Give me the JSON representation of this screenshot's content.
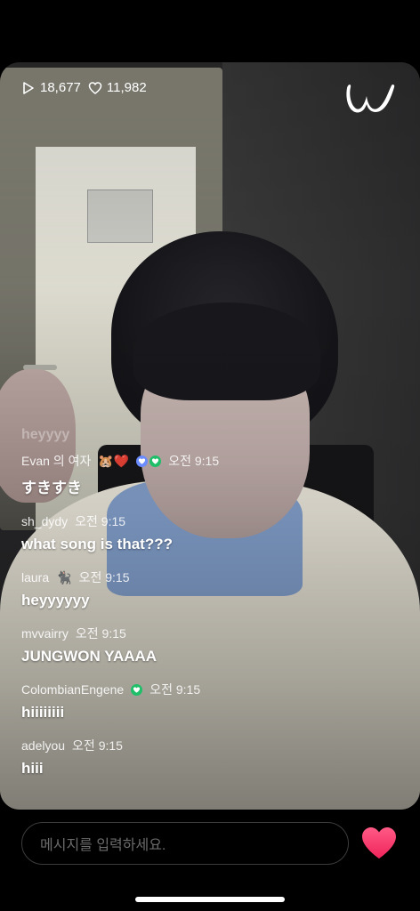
{
  "stats": {
    "plays": "18,677",
    "likes": "11,982"
  },
  "colors": {
    "heart": "#ff3d6e",
    "verify_green": "#1fbf6a",
    "verify_blue": "#6b8cff"
  },
  "chat": {
    "ghost_text": "heyyyy",
    "messages": [
      {
        "user": "Evan 의 여자",
        "emojis": "🐹❤️",
        "badges": [
          "purple-heart-badge",
          "green-heart-badge"
        ],
        "time": "오전 9:15",
        "text": "すきすき"
      },
      {
        "user": "sh_dydy",
        "time": "오전 9:15",
        "text": "what song is that???"
      },
      {
        "user": "laura",
        "emojis": "🐈‍⬛",
        "time": "오전 9:15",
        "text": "heyyyyyy"
      },
      {
        "user": "mvvairry",
        "time": "오전 9:15",
        "text": "JUNGWON YAAAA"
      },
      {
        "user": "ColombianEngene",
        "badges": [
          "green-heart-badge"
        ],
        "time": "오전 9:15",
        "text": "hiiiiiiii"
      },
      {
        "user": "adelyou",
        "time": "오전 9:15",
        "text": "hiii"
      }
    ]
  },
  "input": {
    "placeholder": "메시지를 입력하세요."
  },
  "icons": {
    "play": "play-icon",
    "like": "heart-outline-icon",
    "logo": "weverse-logo",
    "send_heart": "heart-icon"
  }
}
